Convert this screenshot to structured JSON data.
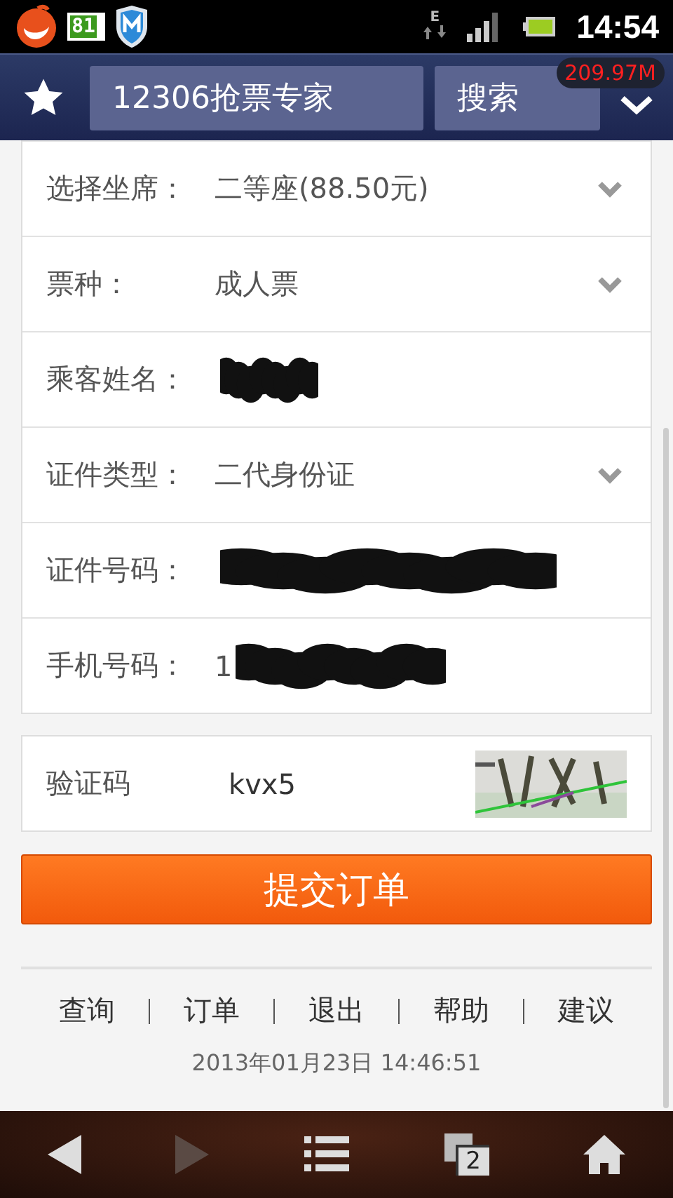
{
  "status_bar": {
    "battery_app": "81",
    "network": "E",
    "time": "14:54"
  },
  "toolbar": {
    "url": "12306抢票专家",
    "search_button": "搜索",
    "memory": "209.97M"
  },
  "form_rows": [
    {
      "kind": "select",
      "label": "选择坐席：",
      "value": "二等座(88.50元)"
    },
    {
      "kind": "select",
      "label": "票种：",
      "value": "成人票"
    },
    {
      "kind": "text",
      "label": "乘客姓名：",
      "redacted": true
    },
    {
      "kind": "select",
      "label": "证件类型：",
      "value": "二代身份证"
    },
    {
      "kind": "text",
      "label": "证件号码：",
      "redacted": true
    },
    {
      "kind": "text",
      "label": "手机号码：",
      "value": "1",
      "redacted": true
    }
  ],
  "captcha": {
    "label": "验证码",
    "value": "kvx5"
  },
  "submit_button": "提交订单",
  "footer_links": [
    "查询",
    "订单",
    "退出",
    "帮助",
    "建议"
  ],
  "timestamp": "2013年01月23日 14:46:51",
  "bottom_bar": {
    "tab_count": "2",
    "forward_disabled": true
  }
}
